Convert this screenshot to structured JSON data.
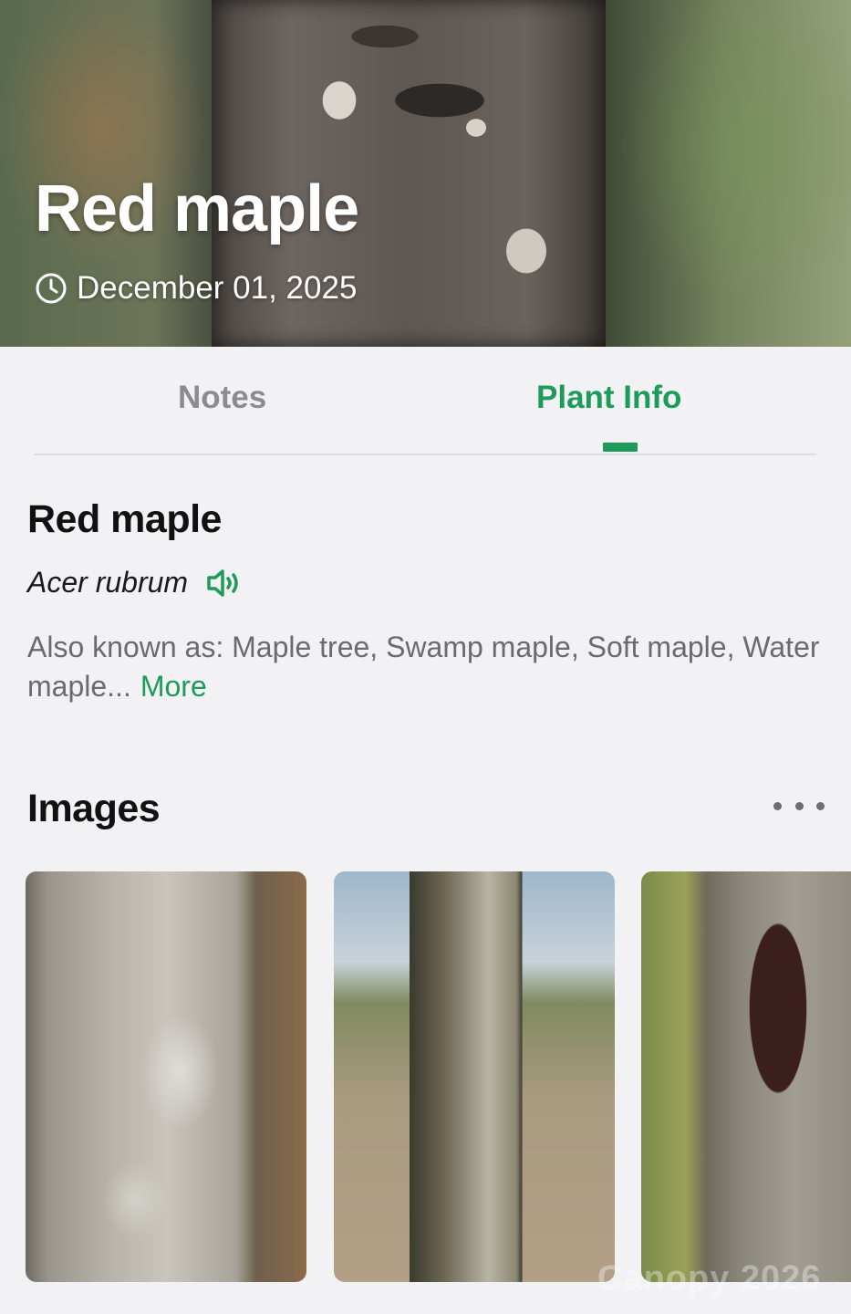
{
  "hero": {
    "title": "Red maple",
    "date": "December 01, 2025",
    "date_icon": "clock-icon"
  },
  "tabs": [
    {
      "label": "Notes",
      "active": false
    },
    {
      "label": "Plant Info",
      "active": true
    }
  ],
  "plant": {
    "common_name": "Red maple",
    "scientific_name": "Acer rubrum",
    "pronounce_icon": "speaker-icon",
    "also_known_as": "Also known as: Maple tree, Swamp maple, Soft maple, Water maple...",
    "more_label": "More"
  },
  "images": {
    "heading": "Images",
    "menu_icon": "more-horizontal-icon",
    "thumbnails": [
      "bark-photo-1",
      "bark-photo-2",
      "bark-photo-3"
    ]
  },
  "watermark": "Canopy 2026",
  "colors": {
    "accent": "#1e9a5a",
    "background": "#f2f2f4",
    "muted_text": "#6b6b6d"
  }
}
